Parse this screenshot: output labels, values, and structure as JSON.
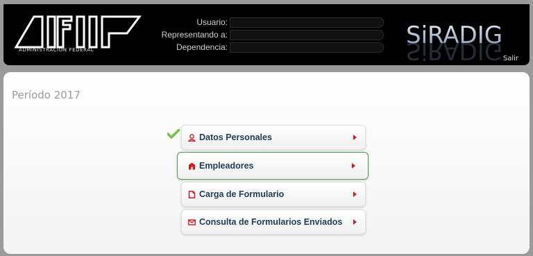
{
  "header": {
    "logo_subtitle": "ADMINISTRACION FEDERAL",
    "app_name": "SiRADIG",
    "logout_label": "Salir",
    "user_fields": [
      {
        "label": "Usuario:",
        "value": ""
      },
      {
        "label": "Representando a:",
        "value": ""
      },
      {
        "label": "Dependencia:",
        "value": ""
      }
    ]
  },
  "main": {
    "period_title": "Período 2017",
    "menu": [
      {
        "label": "Datos Personales",
        "icon": "user-icon",
        "completed": true
      },
      {
        "label": "Empleadores",
        "icon": "building-icon",
        "selected": true
      },
      {
        "label": "Carga de Formulario",
        "icon": "document-icon"
      },
      {
        "label": "Consulta de Formularios Enviados",
        "icon": "envelope-icon"
      }
    ]
  },
  "colors": {
    "header_bg": "#000000",
    "menu_text": "#1f3a5a",
    "arrow_red": "#d01c1c",
    "selected_border": "#4e9a4e",
    "check_green": "#7ac043"
  }
}
